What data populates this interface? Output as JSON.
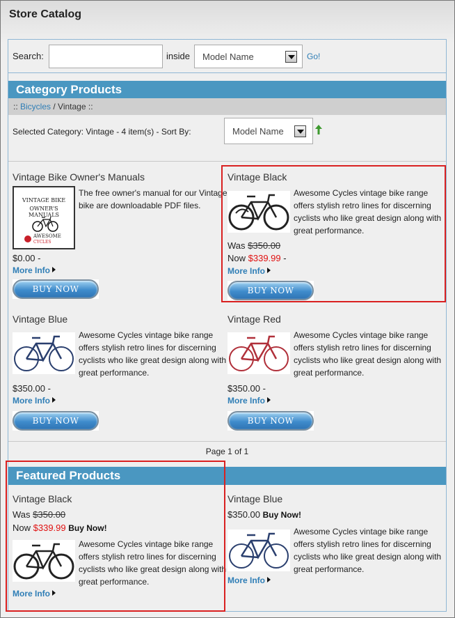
{
  "page": {
    "title": "Store Catalog"
  },
  "search": {
    "label": "Search:",
    "placeholder": "",
    "inside_label": "inside",
    "field_value": "Model Name",
    "go_label": "Go!"
  },
  "category": {
    "heading": "Category Products",
    "breadcrumb_prefix": "::",
    "breadcrumb_link": "Bicycles",
    "breadcrumb_current": "/ Vintage ::",
    "selected_text": "Selected Category: Vintage - 4 item(s) - Sort By:",
    "sort_value": "Model Name",
    "page_info": "Page 1 of 1"
  },
  "products": [
    {
      "name": "Vintage Bike Owner's Manuals",
      "desc": "The free owner's manual for our Vintage bike are downloadable PDF files.",
      "price": "$0.00 -",
      "more": "More Info",
      "buy": "BUY NOW",
      "image_lines": [
        "VINTAGE BIKE",
        "OWNER'S MANUALS",
        "AWESOME",
        "CYCLES"
      ]
    },
    {
      "name": "Vintage Black",
      "desc": "Awesome Cycles vintage bike range offers stylish retro lines for discerning cyclists who like great design along with great performance.",
      "was_label": "Was",
      "was_price": "$350.00",
      "now_label": "Now",
      "now_price": "$339.99",
      "now_suffix": "-",
      "more": "More Info",
      "buy": "BUY NOW",
      "bike_color": "#222222"
    },
    {
      "name": "Vintage Blue",
      "desc": "Awesome Cycles vintage bike range offers stylish retro lines for discerning cyclists who like great design along with great performance.",
      "price": "$350.00 -",
      "more": "More Info",
      "buy": "BUY NOW",
      "bike_color": "#2a3f6e"
    },
    {
      "name": "Vintage Red",
      "desc": "Awesome Cycles vintage bike range offers stylish retro lines for discerning cyclists who like great design along with great performance.",
      "price": "$350.00 -",
      "more": "More Info",
      "buy": "BUY NOW",
      "bike_color": "#b0303a"
    }
  ],
  "featured": {
    "heading": "Featured Products",
    "items": [
      {
        "name": "Vintage Black",
        "was_label": "Was",
        "was_price": "$350.00",
        "now_label": "Now",
        "now_price": "$339.99",
        "buy_text": "Buy Now!",
        "desc": "Awesome Cycles vintage bike range offers stylish retro lines for discerning cyclists who like great design along with great performance.",
        "more": "More Info"
      },
      {
        "name": "Vintage Blue",
        "price": "$350.00",
        "buy_text": "Buy Now!",
        "desc": "Awesome Cycles vintage bike range offers stylish retro lines for discerning cyclists who like great design along with great performance.",
        "more": "More Info"
      }
    ]
  },
  "colors": {
    "accent": "#4a97c1",
    "link": "#2f7eb6",
    "sale": "#e01010",
    "highlight": "#d92020"
  }
}
